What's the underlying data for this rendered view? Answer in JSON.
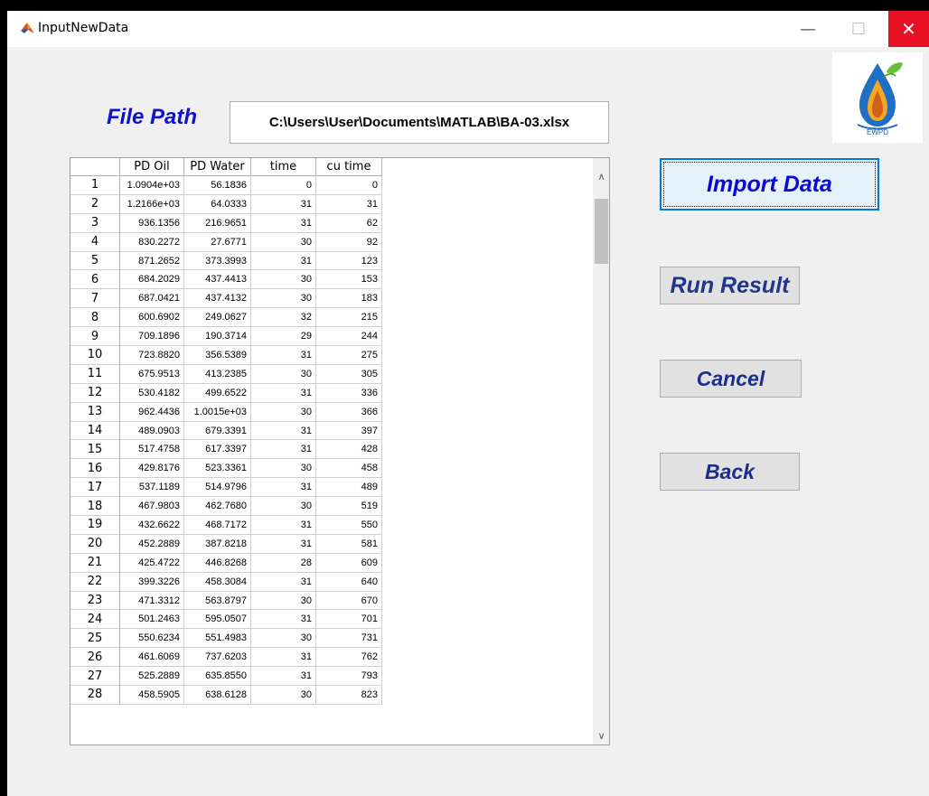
{
  "window": {
    "title": "InputNewData",
    "minimize_glyph": "—",
    "maximize_glyph": "☐",
    "close_glyph": "✕"
  },
  "logo": {
    "text": "EWPD"
  },
  "file_path": {
    "label": "File Path",
    "value": "C:\\Users\\User\\Documents\\MATLAB\\BA-03.xlsx"
  },
  "table": {
    "columns": [
      "",
      "PD Oil",
      "PD Water",
      "time",
      "cu time"
    ],
    "rows": [
      [
        "1",
        "1.0904e+03",
        "56.1836",
        "0",
        "0"
      ],
      [
        "2",
        "1.2166e+03",
        "64.0333",
        "31",
        "31"
      ],
      [
        "3",
        "936.1356",
        "216.9651",
        "31",
        "62"
      ],
      [
        "4",
        "830.2272",
        "27.6771",
        "30",
        "92"
      ],
      [
        "5",
        "871.2652",
        "373.3993",
        "31",
        "123"
      ],
      [
        "6",
        "684.2029",
        "437.4413",
        "30",
        "153"
      ],
      [
        "7",
        "687.0421",
        "437.4132",
        "30",
        "183"
      ],
      [
        "8",
        "600.6902",
        "249.0627",
        "32",
        "215"
      ],
      [
        "9",
        "709.1896",
        "190.3714",
        "29",
        "244"
      ],
      [
        "10",
        "723.8820",
        "356.5389",
        "31",
        "275"
      ],
      [
        "11",
        "675.9513",
        "413.2385",
        "30",
        "305"
      ],
      [
        "12",
        "530.4182",
        "499.6522",
        "31",
        "336"
      ],
      [
        "13",
        "962.4436",
        "1.0015e+03",
        "30",
        "366"
      ],
      [
        "14",
        "489.0903",
        "679.3391",
        "31",
        "397"
      ],
      [
        "15",
        "517.4758",
        "617.3397",
        "31",
        "428"
      ],
      [
        "16",
        "429.8176",
        "523.3361",
        "30",
        "458"
      ],
      [
        "17",
        "537.1189",
        "514.9796",
        "31",
        "489"
      ],
      [
        "18",
        "467.9803",
        "462.7680",
        "30",
        "519"
      ],
      [
        "19",
        "432.6622",
        "468.7172",
        "31",
        "550"
      ],
      [
        "20",
        "452.2889",
        "387.8218",
        "31",
        "581"
      ],
      [
        "21",
        "425.4722",
        "446.8268",
        "28",
        "609"
      ],
      [
        "22",
        "399.3226",
        "458.3084",
        "31",
        "640"
      ],
      [
        "23",
        "471.3312",
        "563.8797",
        "30",
        "670"
      ],
      [
        "24",
        "501.2463",
        "595.0507",
        "31",
        "701"
      ],
      [
        "25",
        "550.6234",
        "551.4983",
        "30",
        "731"
      ],
      [
        "26",
        "461.6069",
        "737.6203",
        "31",
        "762"
      ],
      [
        "27",
        "525.2889",
        "635.8550",
        "31",
        "793"
      ],
      [
        "28",
        "458.5905",
        "638.6128",
        "30",
        "823"
      ]
    ],
    "scroll_up_glyph": "∧",
    "scroll_down_glyph": "∨"
  },
  "buttons": {
    "import": "Import Data",
    "run": "Run Result",
    "cancel": "Cancel",
    "back": "Back"
  }
}
